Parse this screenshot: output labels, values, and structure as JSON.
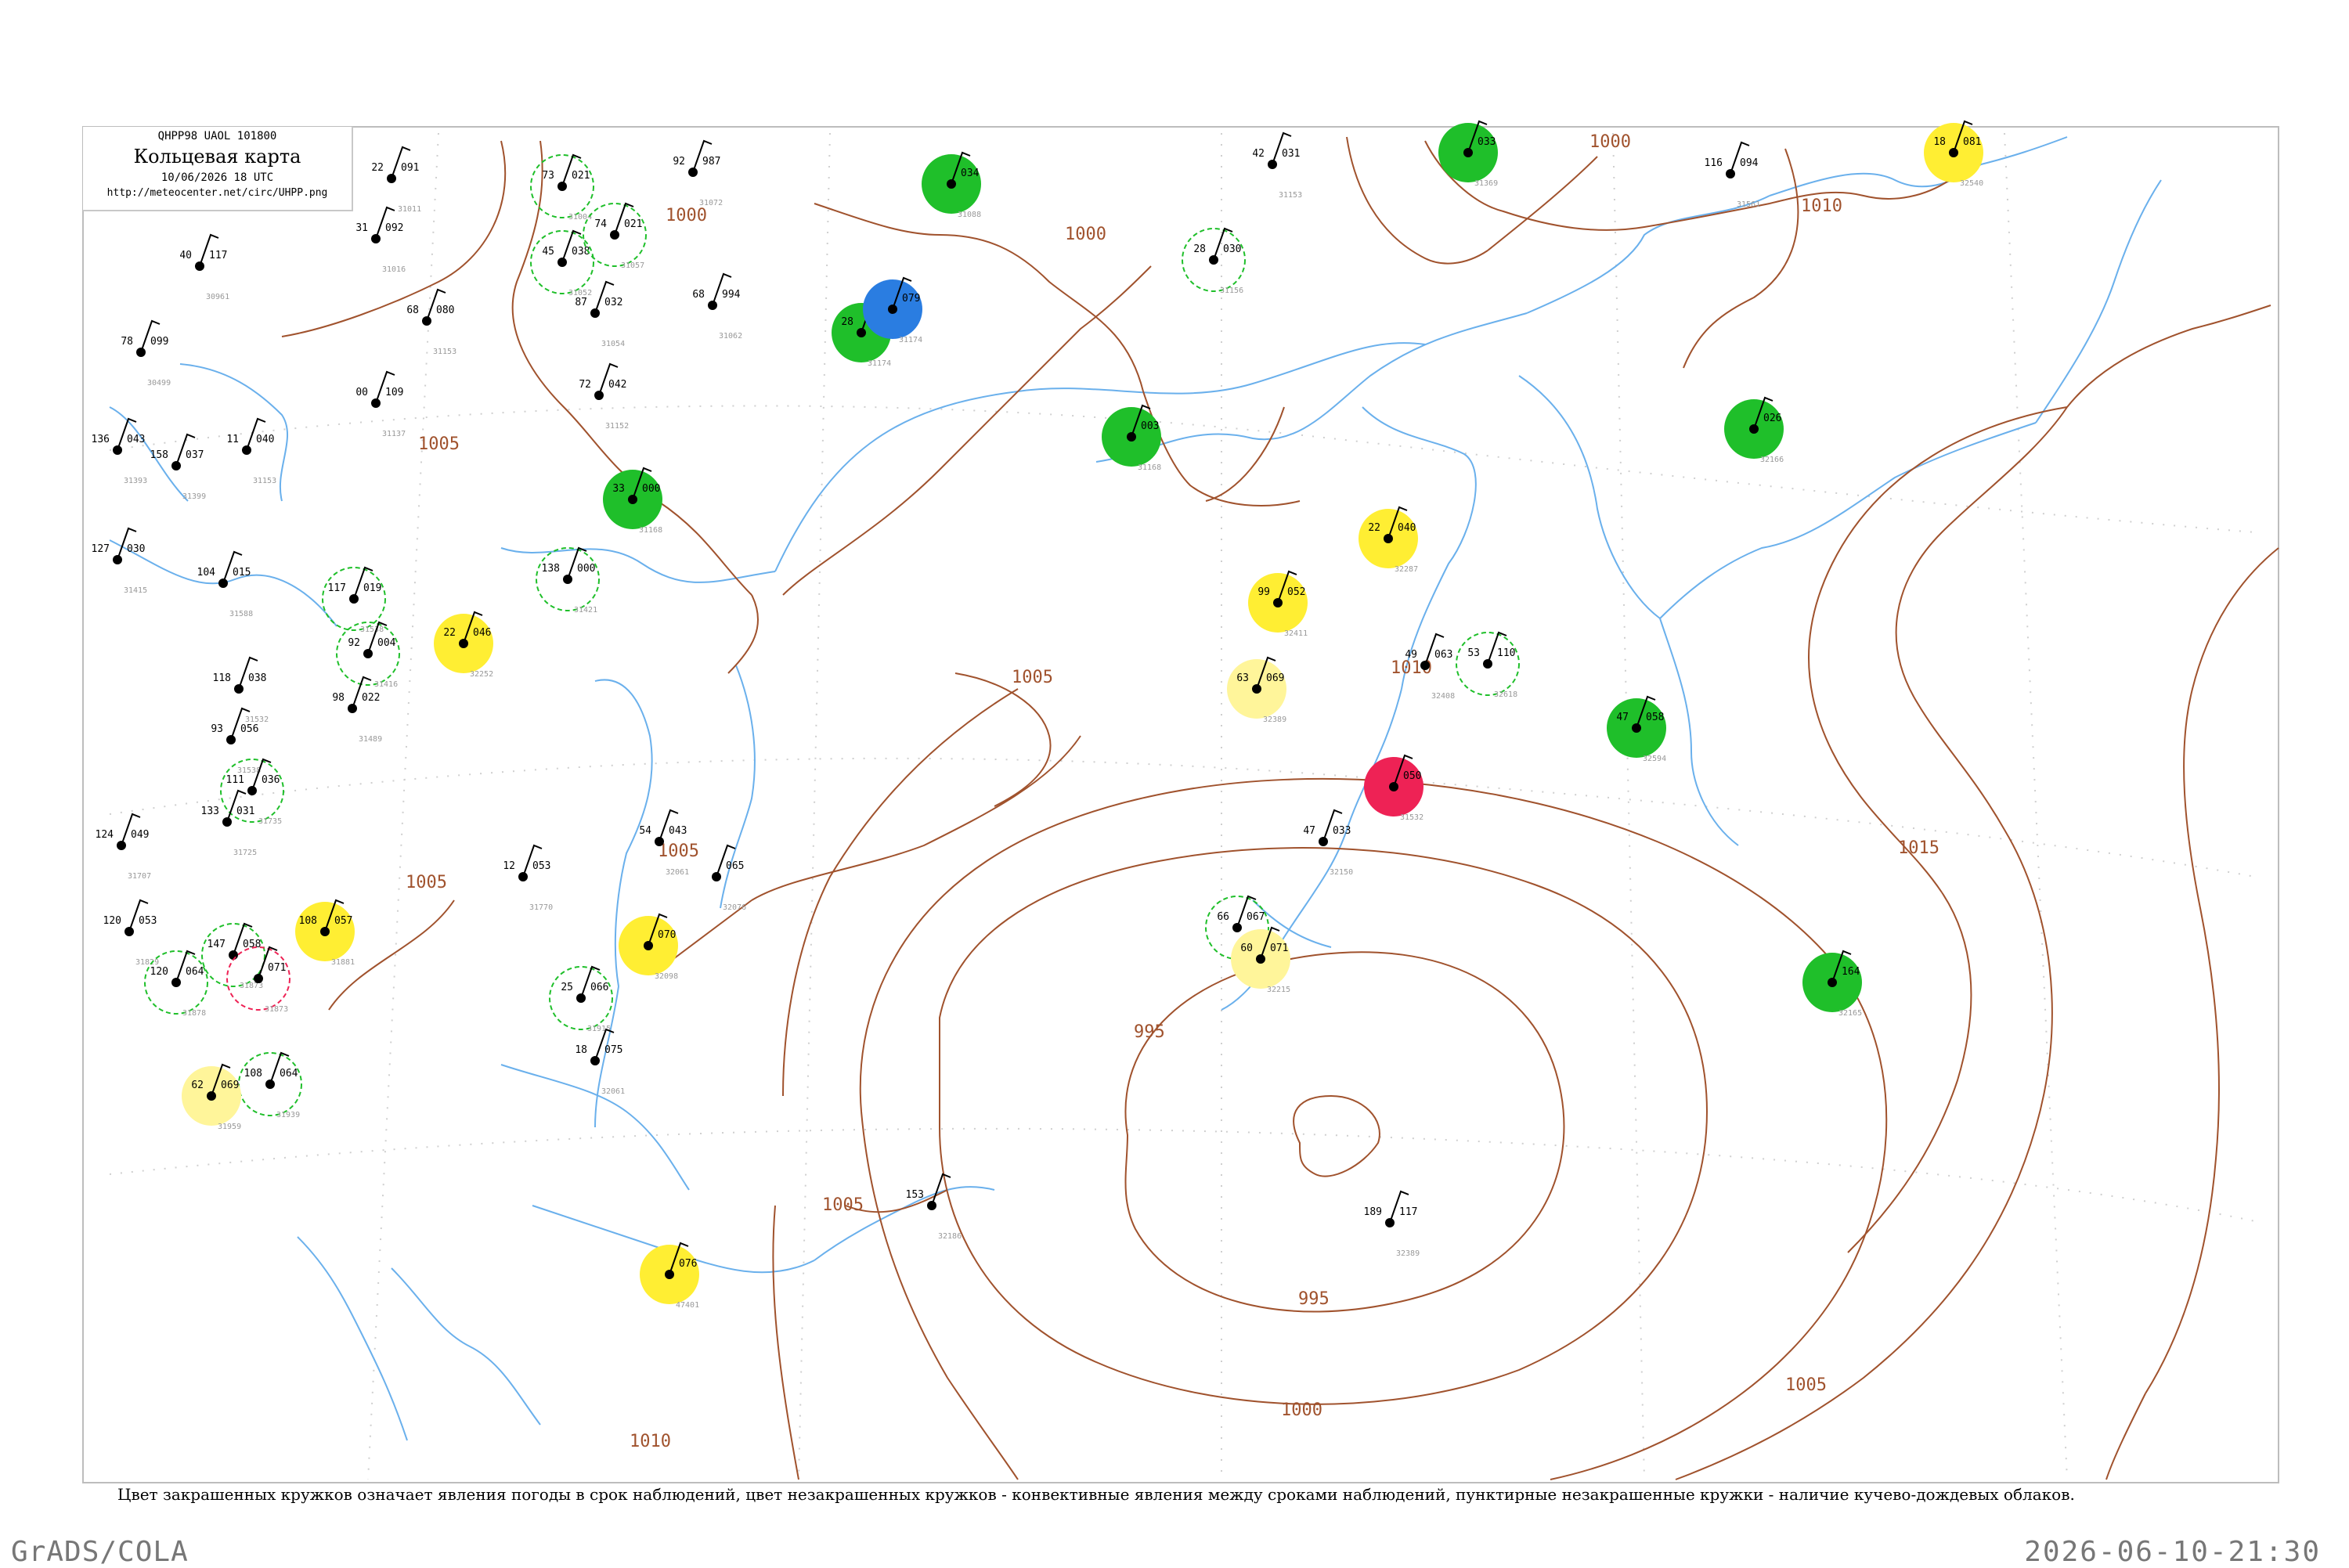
{
  "header": {
    "code": "QHPP98  UAOL  101800",
    "title": "Кольцевая карта",
    "time": "10/06/2026 18 UTC",
    "url": "http://meteocenter.net/circ/UHPP.png"
  },
  "caption": "Цвет закрашенных кружков означает явления погоды в срок наблюдений, цвет незакрашенных кружков - конвективные явления между сроками наблюдений, пунктирные незакрашенные кружки - наличие кучево-дождевых облаков.",
  "footer": {
    "software": "GrADS/COLA",
    "datetime": "2026-06-10-21:30"
  },
  "colors": {
    "isobar": "#a0522d",
    "river": "#5aa7e6",
    "green": "#1fbf2a",
    "yellow": "#ffee33",
    "blue": "#2a7de1",
    "red": "#ee2255",
    "pale_yellow": "#fff59a",
    "station_name": "#999999"
  },
  "isobar_labels": [
    "1000",
    "1000",
    "1000",
    "1005",
    "1005",
    "1005",
    "1005",
    "1005",
    "1010",
    "1010",
    "1015",
    "995",
    "995",
    "1000",
    "1005",
    "1010"
  ],
  "stations": [
    {
      "p": "091",
      "t": "22",
      "id": "31011",
      "mark": "none"
    },
    {
      "p": "099",
      "t": "78",
      "id": "30499",
      "mark": "none"
    },
    {
      "p": "117",
      "t": "40",
      "id": "30961",
      "mark": "none"
    },
    {
      "p": "092",
      "t": "31",
      "id": "31016",
      "mark": "none"
    },
    {
      "p": "080",
      "t": "68",
      "id": "31153",
      "mark": "none"
    },
    {
      "p": "109",
      "t": "00",
      "id": "31137",
      "mark": "none"
    },
    {
      "p": "040",
      "t": "11",
      "id": "31153",
      "mark": "none"
    },
    {
      "p": "043",
      "t": "136",
      "id": "31393",
      "mark": "none"
    },
    {
      "p": "037",
      "t": "158",
      "id": "31399",
      "mark": "none"
    },
    {
      "p": "030",
      "t": "127",
      "id": "31415",
      "mark": "none"
    },
    {
      "p": "015",
      "t": "104",
      "id": "31588",
      "mark": "none"
    },
    {
      "p": "038",
      "t": "118",
      "id": "31532",
      "mark": "none"
    },
    {
      "p": "021",
      "t": "73",
      "id": "31004",
      "mark": "green-ring"
    },
    {
      "p": "038",
      "t": "45",
      "id": "31052",
      "mark": "green-ring"
    },
    {
      "p": "021",
      "t": "74",
      "id": "31057",
      "mark": "green-ring"
    },
    {
      "p": "032",
      "t": "87",
      "id": "31054",
      "mark": "none"
    },
    {
      "p": "042",
      "t": "72",
      "id": "31152",
      "mark": "none"
    },
    {
      "p": "987",
      "t": "92",
      "id": "31072",
      "mark": "none"
    },
    {
      "p": "994",
      "t": "68",
      "id": "31062",
      "mark": "none"
    },
    {
      "p": "034",
      "t": "",
      "id": "31088",
      "mark": "green"
    },
    {
      "p": "032",
      "t": "28",
      "id": "31174",
      "mark": "green"
    },
    {
      "p": "079",
      "t": "",
      "id": "31174",
      "mark": "blue"
    },
    {
      "p": "031",
      "t": "42",
      "id": "31153",
      "mark": "none"
    },
    {
      "p": "000",
      "t": "33",
      "id": "31168",
      "mark": "green"
    },
    {
      "p": "094",
      "t": "116",
      "id": "31561",
      "mark": "none"
    },
    {
      "p": "081",
      "t": "18",
      "id": "32540",
      "mark": "yellow"
    },
    {
      "p": "030",
      "t": "28",
      "id": "31156",
      "mark": "green-ring"
    },
    {
      "p": "033",
      "t": "",
      "id": "31369",
      "mark": "green"
    },
    {
      "p": "026",
      "t": "",
      "id": "32166",
      "mark": "green"
    },
    {
      "p": "003",
      "t": "",
      "id": "31168",
      "mark": "green"
    },
    {
      "p": "000",
      "t": "138",
      "id": "31421",
      "mark": "green-ring"
    },
    {
      "p": "019",
      "t": "117",
      "id": "31538",
      "mark": "green-ring"
    },
    {
      "p": "004",
      "t": "92",
      "id": "31416",
      "mark": "green-ring"
    },
    {
      "p": "046",
      "t": "22",
      "id": "32252",
      "mark": "yellow"
    },
    {
      "p": "040",
      "t": "22",
      "id": "32287",
      "mark": "yellow"
    },
    {
      "p": "052",
      "t": "99",
      "id": "32411",
      "mark": "yellow"
    },
    {
      "p": "069",
      "t": "63",
      "id": "32389",
      "mark": "pale-yellow"
    },
    {
      "p": "063",
      "t": "49",
      "id": "32408",
      "mark": "none"
    },
    {
      "p": "110",
      "t": "53",
      "id": "32618",
      "mark": "green-ring"
    },
    {
      "p": "058",
      "t": "47",
      "id": "32594",
      "mark": "green"
    },
    {
      "p": "050",
      "t": "",
      "id": "31532",
      "mark": "red"
    },
    {
      "p": "056",
      "t": "93",
      "id": "31538",
      "mark": "none"
    },
    {
      "p": "022",
      "t": "98",
      "id": "31489",
      "mark": "none"
    },
    {
      "p": "036",
      "t": "111",
      "id": "31735",
      "mark": "green-ring"
    },
    {
      "p": "031",
      "t": "133",
      "id": "31725",
      "mark": "none"
    },
    {
      "p": "049",
      "t": "124",
      "id": "31707",
      "mark": "none"
    },
    {
      "p": "053",
      "t": "120",
      "id": "31829",
      "mark": "none"
    },
    {
      "p": "057",
      "t": "108",
      "id": "31881",
      "mark": "yellow"
    },
    {
      "p": "058",
      "t": "147",
      "id": "31873",
      "mark": "green-ring"
    },
    {
      "p": "064",
      "t": "120",
      "id": "31878",
      "mark": "green-ring"
    },
    {
      "p": "071",
      "t": "",
      "id": "31873",
      "mark": "red-ring"
    },
    {
      "p": "064",
      "t": "108",
      "id": "31939",
      "mark": "green-ring"
    },
    {
      "p": "069",
      "t": "62",
      "id": "31959",
      "mark": "pale-yellow"
    },
    {
      "p": "070",
      "t": "",
      "id": "32098",
      "mark": "yellow"
    },
    {
      "p": "066",
      "t": "25",
      "id": "31915",
      "mark": "green-ring"
    },
    {
      "p": "075",
      "t": "18",
      "id": "32061",
      "mark": "none"
    },
    {
      "p": "053",
      "t": "12",
      "id": "31770",
      "mark": "none"
    },
    {
      "p": "043",
      "t": "54",
      "id": "32061",
      "mark": "none"
    },
    {
      "p": "065",
      "t": "",
      "id": "32076",
      "mark": "none"
    },
    {
      "p": "033",
      "t": "47",
      "id": "32150",
      "mark": "none"
    },
    {
      "p": "067",
      "t": "66",
      "id": "32165",
      "mark": "green-ring"
    },
    {
      "p": "071",
      "t": "60",
      "id": "32215",
      "mark": "pale-yellow"
    },
    {
      "p": "164",
      "t": "",
      "id": "32165",
      "mark": "green"
    },
    {
      "p": "076",
      "t": "",
      "id": "47401",
      "mark": "yellow"
    },
    {
      "p": "117",
      "t": "189",
      "id": "32389",
      "mark": "none"
    },
    {
      "p": "",
      "t": "153",
      "id": "32186",
      "mark": "none"
    }
  ]
}
